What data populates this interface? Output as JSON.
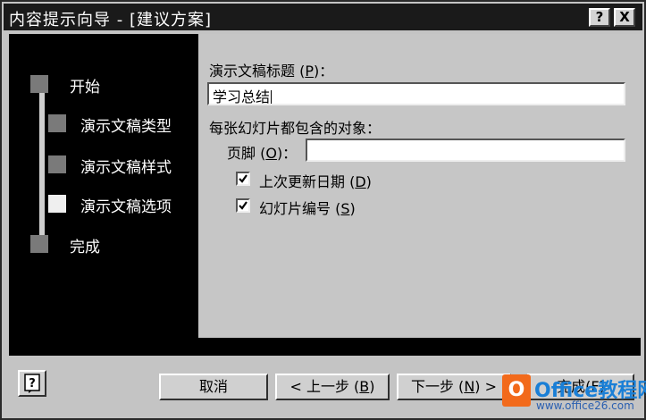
{
  "window": {
    "title": "内容提示向导 - [建议方案]",
    "help_button": "?",
    "close_button": "X"
  },
  "steps": [
    {
      "label": "开始",
      "state": "done"
    },
    {
      "label": "演示文稿类型",
      "state": "done"
    },
    {
      "label": "演示文稿样式",
      "state": "done"
    },
    {
      "label": "演示文稿选项",
      "state": "current"
    },
    {
      "label": "完成",
      "state": "pending"
    }
  ],
  "form": {
    "title_label": "演示文稿标题 (",
    "title_label_key": "P",
    "title_label_end": ")：",
    "title_value": "学习总结",
    "objects_label": "每张幻灯片都包含的对象：",
    "footer_label": "页脚 (",
    "footer_key": "O",
    "footer_label_end": ")：",
    "footer_value": "",
    "date_label": "上次更新日期 (",
    "date_key": "D",
    "date_label_end": ")",
    "date_checked": true,
    "slide_num_label": "幻灯片编号 (",
    "slide_num_key": "S",
    "slide_num_label_end": ")",
    "slide_num_checked": true
  },
  "buttons": {
    "assistant": "?",
    "cancel": "取消",
    "back": "< 上一步 (",
    "back_key": "B",
    "back_end": ")",
    "next": "下一步 (",
    "next_key": "N",
    "next_end": ") >",
    "finish": "完成(F)"
  },
  "watermark": {
    "logo": "O",
    "brand": "Office教程网",
    "url": "www.office26.com"
  }
}
